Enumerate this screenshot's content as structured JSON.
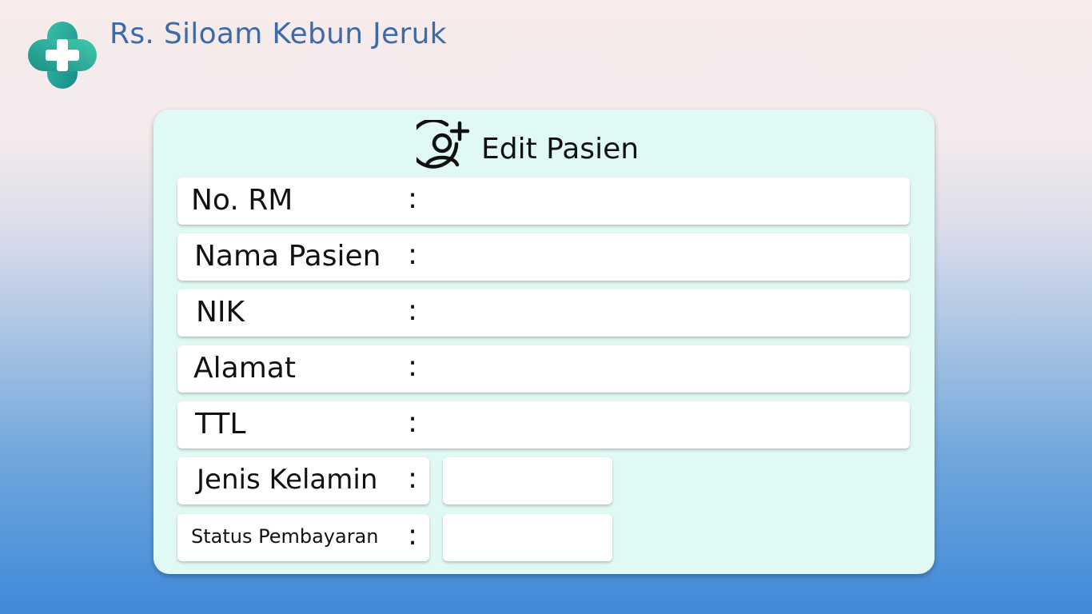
{
  "app": {
    "title": "Rs. Siloam Kebun Jeruk"
  },
  "form": {
    "title": "Edit Pasien",
    "icon": "user-plus-icon",
    "colon": ":",
    "fields": [
      {
        "label": "No. RM",
        "value": ""
      },
      {
        "label": "Nama Pasien",
        "value": ""
      },
      {
        "label": "NIK",
        "value": ""
      },
      {
        "label": "Alamat",
        "value": ""
      },
      {
        "label": "TTL",
        "value": ""
      },
      {
        "label": "Jenis Kelamin",
        "value": ""
      },
      {
        "label": "Status Pembayaran",
        "value": ""
      }
    ]
  },
  "colors": {
    "brand_text": "#3d6aa8",
    "card_bg": "#e1f9f4",
    "logo_gradient": [
      "#1f9e8c",
      "#2fb8a7"
    ]
  }
}
